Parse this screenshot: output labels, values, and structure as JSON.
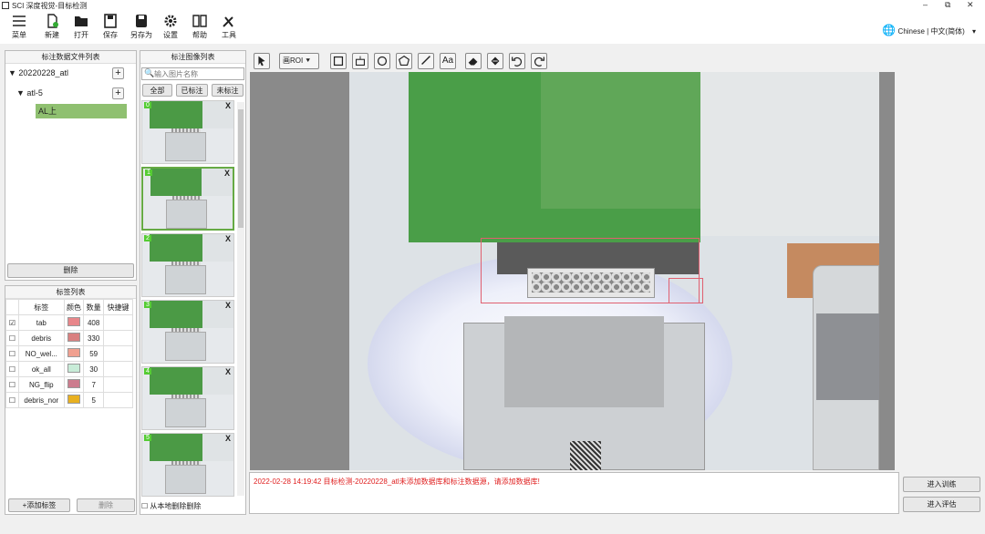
{
  "window": {
    "title": "SCI 深度视觉-目标检测",
    "minimize": "–",
    "restore": "⧉",
    "close": "✕"
  },
  "toolbar": {
    "items": [
      {
        "label": "菜单",
        "icon": "menu-icon"
      },
      {
        "label": "新建",
        "icon": "new-file-icon"
      },
      {
        "label": "打开",
        "icon": "open-folder-icon"
      },
      {
        "label": "保存",
        "icon": "save-icon"
      },
      {
        "label": "另存为",
        "icon": "save-as-icon"
      },
      {
        "label": "设置",
        "icon": "gear-icon"
      },
      {
        "label": "帮助",
        "icon": "help-book-icon"
      },
      {
        "label": "工具",
        "icon": "tools-icon"
      }
    ],
    "language": "Chinese | 中文(简体)"
  },
  "file_panel": {
    "title": "标注数据文件列表",
    "tree": [
      {
        "label": "20220228_atl"
      },
      {
        "label": "atl-5"
      },
      {
        "label": "AL上"
      }
    ],
    "delete_label": "删除"
  },
  "label_panel": {
    "title": "标签列表",
    "headers": [
      "标签",
      "颜色",
      "数量",
      "快捷键"
    ],
    "rows": [
      {
        "checked": "☑",
        "name": "tab",
        "color": "#e8868a",
        "count": "408"
      },
      {
        "checked": "☐",
        "name": "debris",
        "color": "#d98080",
        "count": "330"
      },
      {
        "checked": "☐",
        "name": "NO_wel...",
        "color": "#f0a090",
        "count": "59"
      },
      {
        "checked": "☐",
        "name": "ok_all",
        "color": "#c8ecd8",
        "count": "30"
      },
      {
        "checked": "☐",
        "name": "NG_flip",
        "color": "#cc7c8e",
        "count": "7"
      },
      {
        "checked": "☐",
        "name": "debris_nor",
        "color": "#e8b020",
        "count": "5"
      }
    ],
    "add_label": "+添加标签",
    "delete_label": "删除"
  },
  "image_panel": {
    "title": "标注图像列表",
    "search_placeholder": "输入图片名称",
    "filters": [
      "全部",
      "已标注",
      "未标注"
    ],
    "thumbs": [
      "0",
      "1",
      "2",
      "3",
      "4",
      "5"
    ],
    "delete_local": "从本地删除删除"
  },
  "canvas_toolbar": {
    "roi_label": "画ROI"
  },
  "log": {
    "message": "2022-02-28 14:19:42 目标检测-20220228_atl未添加数据库和标注数据源，请添加数据库!"
  },
  "actions": {
    "train": "进入训练",
    "eval": "进入评估"
  }
}
